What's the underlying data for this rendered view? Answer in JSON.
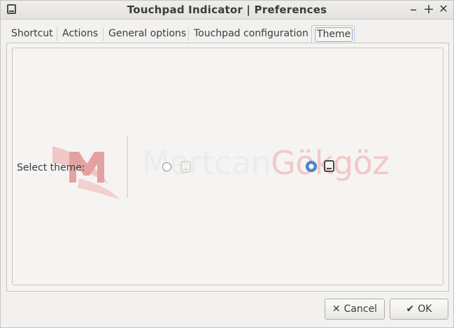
{
  "window": {
    "title": "Touchpad Indicator | Preferences",
    "icons": {
      "app": "touchpad-icon",
      "minimize": "minimize-icon",
      "maximize": "maximize-icon",
      "close": "close-icon"
    },
    "controls": {
      "minimize_glyph": "–",
      "maximize_glyph": "+",
      "close_glyph": "✕"
    }
  },
  "tabs": [
    {
      "label": "Shortcut"
    },
    {
      "label": "Actions"
    },
    {
      "label": "General options"
    },
    {
      "label": "Touchpad configuration"
    },
    {
      "label": "Theme",
      "selected": true
    }
  ],
  "theme_panel": {
    "label": "Select theme:",
    "options": [
      {
        "icon": "touchpad-light-icon",
        "selected": false
      },
      {
        "icon": "touchpad-dark-icon",
        "selected": true
      }
    ]
  },
  "watermark": {
    "first": "Mertcan",
    "last": "Gökgöz"
  },
  "buttons": {
    "cancel": {
      "label": "Cancel",
      "icon": "x-icon",
      "glyph": "✕"
    },
    "ok": {
      "label": "OK",
      "icon": "checkmark-icon",
      "glyph": "✔"
    }
  },
  "colors": {
    "accent": "#4a89d6",
    "watermark_red": "#e8a0a0"
  }
}
